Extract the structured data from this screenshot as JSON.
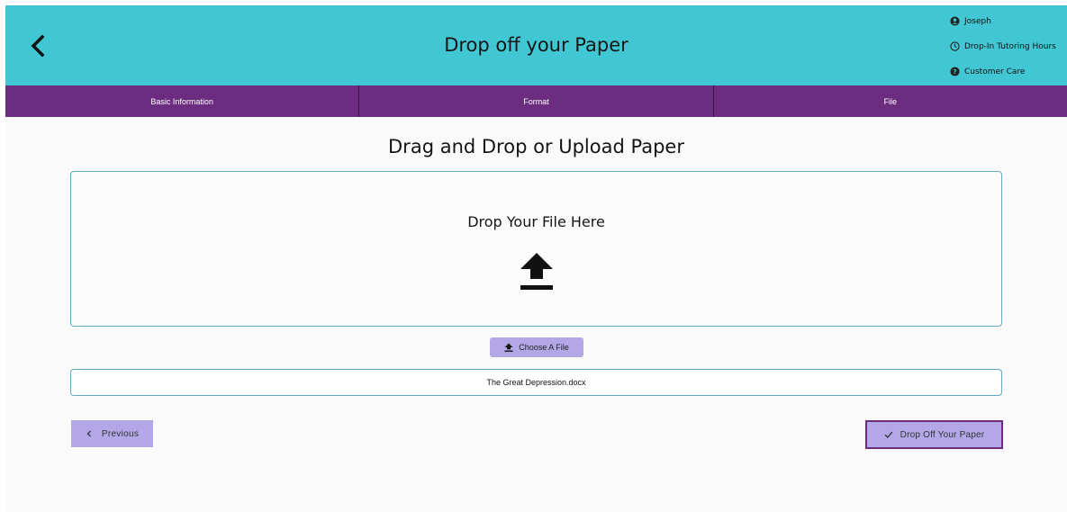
{
  "header": {
    "title": "Drop off your Paper",
    "back_icon": "chevron-left-icon",
    "user_menu": [
      {
        "label": "Joseph",
        "icon": "user-circle-icon"
      },
      {
        "label": "Drop-In Tutoring Hours",
        "icon": "clock-icon"
      },
      {
        "label": "Customer Care",
        "icon": "help-circle-icon"
      }
    ]
  },
  "steps": [
    {
      "label": "Basic Information"
    },
    {
      "label": "Format"
    },
    {
      "label": "File"
    }
  ],
  "upload": {
    "section_title": "Drag and Drop or Upload Paper",
    "dropzone_label": "Drop Your File Here",
    "upload_icon": "upload-icon",
    "choose_label": "Choose A File",
    "filename": "The Great Depression.docx"
  },
  "nav": {
    "previous_label": "Previous",
    "submit_label": "Drop Off Your Paper"
  },
  "colors": {
    "header": "#41c6d3",
    "steps_bar": "#6c2d80",
    "button": "#b3a7e7",
    "border": "#5fa9c2"
  }
}
